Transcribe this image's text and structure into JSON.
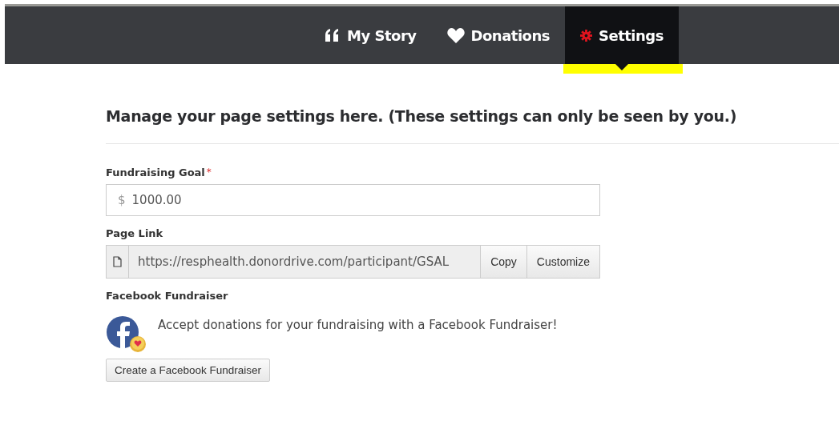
{
  "nav": {
    "tabs": [
      {
        "label": "My Story",
        "kind": "quote",
        "selected": false
      },
      {
        "label": "Donations",
        "kind": "heart",
        "selected": false
      },
      {
        "label": "Settings",
        "kind": "gear",
        "selected": true
      }
    ]
  },
  "heading": "Manage your page settings here. (These settings can only be seen by you.)",
  "goal": {
    "label": "Fundraising Goal",
    "required_mark": "*",
    "prefix": "$",
    "value": "1000.00"
  },
  "page_link": {
    "label": "Page Link",
    "value": "https://resphealth.donordrive.com/participant/GSAL",
    "buttons": [
      "Copy",
      "Customize"
    ]
  },
  "facebook": {
    "label": "Facebook Fundraiser",
    "text": "Accept donations for your fundraising with a Facebook Fundraiser!",
    "button": "Create a Facebook Fundraiser"
  }
}
